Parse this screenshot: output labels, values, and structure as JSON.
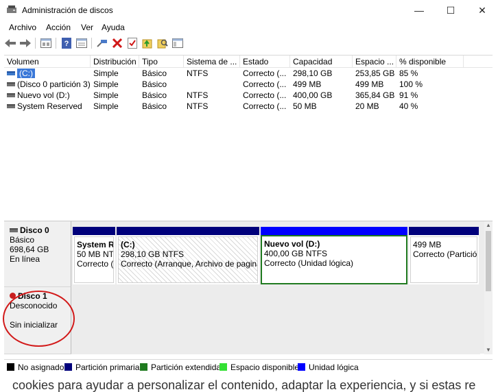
{
  "window": {
    "title": "Administración de discos",
    "minimize_glyph": "—",
    "maximize_glyph": "☐",
    "close_glyph": "✕"
  },
  "menu": [
    "Archivo",
    "Acción",
    "Ver",
    "Ayuda"
  ],
  "toolbar": {
    "icons": [
      "back-icon",
      "forward-icon",
      "properties-icon",
      "help-icon",
      "view-icon",
      "connect-icon",
      "delete-icon",
      "check-icon",
      "folder-up-icon",
      "search-icon",
      "console-icon"
    ]
  },
  "volume_table": {
    "columns": [
      "Volumen",
      "Distribución",
      "Tipo",
      "Sistema de ...",
      "Estado",
      "Capacidad",
      "Espacio ...",
      "% disponible"
    ],
    "rows": [
      [
        "(C:)",
        "Simple",
        "Básico",
        "NTFS",
        "Correcto (...",
        "298,10 GB",
        "253,85 GB",
        "85 %"
      ],
      [
        "(Disco 0 partición 3)",
        "Simple",
        "Básico",
        "",
        "Correcto (...",
        "499 MB",
        "499 MB",
        "100 %"
      ],
      [
        "Nuevo vol (D:)",
        "Simple",
        "Básico",
        "NTFS",
        "Correcto (...",
        "400,00 GB",
        "365,84 GB",
        "91 %"
      ],
      [
        "System Reserved",
        "Simple",
        "Básico",
        "NTFS",
        "Correcto (...",
        "50 MB",
        "20 MB",
        "40 %"
      ]
    ]
  },
  "disks": [
    {
      "name": "Disco 0",
      "type": "Básico",
      "size": "698,64 GB",
      "status": "En línea",
      "partitions": [
        {
          "name": "System R",
          "size": "50 MB NT",
          "status": "Correcto ("
        },
        {
          "name": "(C:)",
          "size": "298,10 GB NTFS",
          "status": "Correcto (Arranque, Archivo de pagina"
        },
        {
          "name": "Nuevo vol  (D:)",
          "size": "400,00 GB NTFS",
          "status": "Correcto (Unidad lógica)"
        },
        {
          "name": "",
          "size": "499 MB",
          "status": "Correcto (Partició"
        }
      ]
    },
    {
      "name": "Disco 1",
      "type": "Desconocido",
      "size": "",
      "status": "Sin inicializar"
    }
  ],
  "colors": {
    "primary_partition": "#00007b",
    "extended_partition": "#1f7a1f",
    "free_space": "#34e034",
    "logical_drive": "#0000ff",
    "unallocated": "#000000",
    "annotation_circle": "#d21919"
  },
  "legend": [
    {
      "label": "No asignado",
      "color": "#000000"
    },
    {
      "label": "Partición primaria",
      "color": "#00007b"
    },
    {
      "label": "Partición extendida",
      "color": "#1f7a1f"
    },
    {
      "label": "Espacio disponible",
      "color": "#34e034"
    },
    {
      "label": "Unidad lógica",
      "color": "#0000ff"
    }
  ],
  "background_text": "cookies para ayudar a personalizar el contenido, adaptar la experiencia, y si estas re"
}
